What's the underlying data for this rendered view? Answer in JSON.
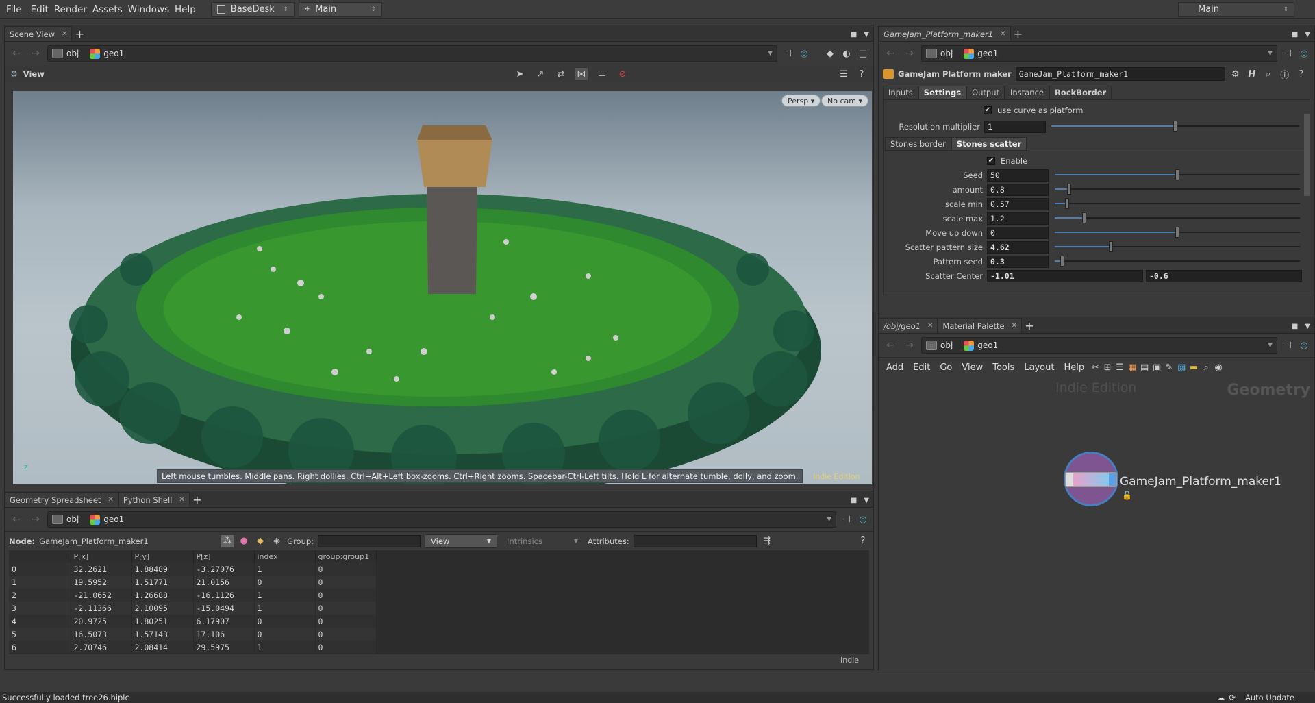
{
  "menu": [
    "File",
    "Edit",
    "Render",
    "Assets",
    "Windows",
    "Help"
  ],
  "desktop": {
    "name": "BaseDesk",
    "context": "Main",
    "right_context": "Main"
  },
  "scene_view": {
    "tab_label": "Scene View",
    "path": [
      "obj",
      "geo1"
    ],
    "view_label": "View",
    "persp": "Persp",
    "cam": "No cam",
    "tooltip": "Left mouse tumbles. Middle pans. Right dollies. Ctrl+Alt+Left box-zooms. Ctrl+Right zooms. Spacebar-Ctrl-Left tilts. Hold L for alternate tumble, dolly, and zoom.",
    "watermark": "Indie Edition"
  },
  "spreadsheet": {
    "tabs": [
      "Geometry Spreadsheet",
      "Python Shell"
    ],
    "path": [
      "obj",
      "geo1"
    ],
    "node_label": "Node:",
    "node_name": "GameJam_Platform_maker1",
    "group_label": "Group:",
    "view_label": "View",
    "intrinsics_label": "Intrinsics",
    "attributes_label": "Attributes:",
    "columns": [
      "",
      "P[x]",
      "P[y]",
      "P[z]",
      "index",
      "group:group1"
    ],
    "rows": [
      [
        "0",
        "32.2621",
        "1.88489",
        "-3.27076",
        "1",
        "0"
      ],
      [
        "1",
        "19.5952",
        "1.51771",
        "21.0156",
        "0",
        "0"
      ],
      [
        "2",
        "-21.0652",
        "1.26688",
        "-16.1126",
        "1",
        "0"
      ],
      [
        "3",
        "-2.11366",
        "2.10095",
        "-15.0494",
        "1",
        "0"
      ],
      [
        "4",
        "20.9725",
        "1.80251",
        "6.17907",
        "0",
        "0"
      ],
      [
        "5",
        "16.5073",
        "1.57143",
        "17.106",
        "0",
        "0"
      ],
      [
        "6",
        "2.70746",
        "2.08414",
        "29.5975",
        "1",
        "0"
      ]
    ],
    "indie": "Indie"
  },
  "params": {
    "tab_label": "GameJam_Platform_maker1",
    "path": [
      "obj",
      "geo1"
    ],
    "node_type": "GameJam Platform maker",
    "node_name": "GameJam_Platform_maker1",
    "tabs": [
      "Inputs",
      "Settings",
      "Output",
      "Instance",
      "RockBorder"
    ],
    "active_tab": "Settings",
    "use_curve_label": "use curve as platform",
    "resolution_label": "Resolution multiplier",
    "resolution_value": "1",
    "sub_tabs": [
      "Stones border",
      "Stones scatter"
    ],
    "enable_label": "Enable",
    "rows": [
      {
        "label": "Seed",
        "value": "50",
        "frac": 0.5,
        "bold": false
      },
      {
        "label": "amount",
        "value": "0.8",
        "frac": 0.06,
        "bold": false
      },
      {
        "label": "scale min",
        "value": "0.57",
        "frac": 0.05,
        "bold": false
      },
      {
        "label": "scale max",
        "value": "1.2",
        "frac": 0.12,
        "bold": false
      },
      {
        "label": "Move up down",
        "value": "0",
        "frac": 0.5,
        "bold": false
      },
      {
        "label": "Scatter pattern size",
        "value": "4.62",
        "frac": 0.23,
        "bold": true
      },
      {
        "label": "Pattern seed",
        "value": "0.3",
        "frac": 0.03,
        "bold": true
      }
    ],
    "scatter_center_label": "Scatter Center",
    "scatter_center": [
      "-1.01",
      "-0.6"
    ]
  },
  "network": {
    "tabs": [
      "/obj/geo1",
      "Material Palette"
    ],
    "path": [
      "obj",
      "geo1"
    ],
    "menus": [
      "Add",
      "Edit",
      "Go",
      "View",
      "Tools",
      "Layout",
      "Help"
    ],
    "watermark": "Indie Edition",
    "context_label": "Geometry",
    "node_label": "GameJam_Platform_maker1"
  },
  "status": {
    "message": "Successfully loaded tree26.hiplc",
    "auto_update": "Auto Update"
  }
}
